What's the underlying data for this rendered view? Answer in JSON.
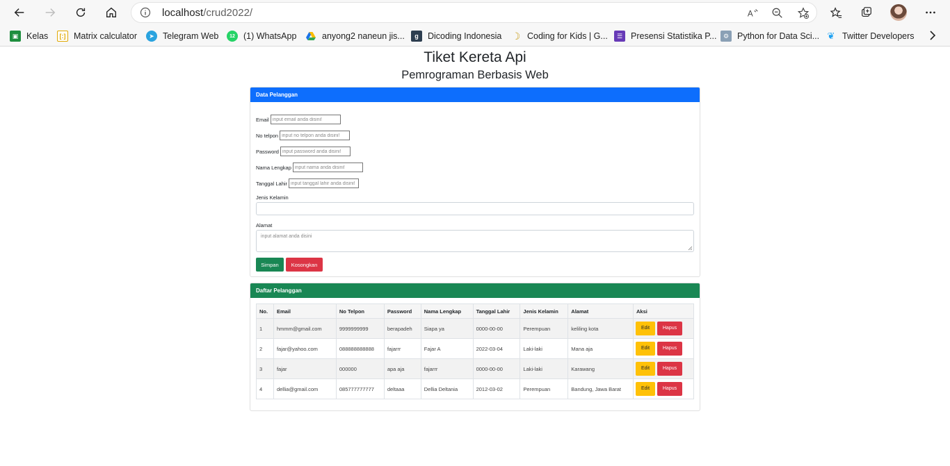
{
  "browser": {
    "url_host": "localhost",
    "url_path": "/crud2022/",
    "bookmarks": [
      {
        "label": "Kelas",
        "icon": "classroom-icon",
        "color": "#1e8e3e"
      },
      {
        "label": "Matrix calculator",
        "icon": "matrix-icon",
        "color": "#e0a800"
      },
      {
        "label": "Telegram Web",
        "icon": "telegram-icon",
        "color": "#2aa3df"
      },
      {
        "label": "(1) WhatsApp",
        "icon": "whatsapp-icon",
        "color": "#25d366"
      },
      {
        "label": "anyong2 naneun jis...",
        "icon": "drive-icon",
        "color": "#fbbc04"
      },
      {
        "label": "Dicoding Indonesia",
        "icon": "dicoding-icon",
        "color": "#2d3e50"
      },
      {
        "label": "Coding for Kids | G...",
        "icon": "banana-icon",
        "color": "#c9a227"
      },
      {
        "label": "Presensi Statistika P...",
        "icon": "forms-icon",
        "color": "#673ab7"
      },
      {
        "label": "Python for Data Sci...",
        "icon": "python-icon",
        "color": "#8aa0b5"
      },
      {
        "label": "Twitter Developers",
        "icon": "twitter-icon",
        "color": "#1da1f2"
      }
    ]
  },
  "page": {
    "title": "Tiket Kereta Api",
    "subtitle": "Pemrograman Berbasis Web"
  },
  "form": {
    "header": "Data Pelanggan",
    "email_label": "Email",
    "email_placeholder": "input email anda disini!",
    "phone_label": "No telpon",
    "phone_placeholder": "input no telpon anda disini!",
    "password_label": "Password",
    "password_placeholder": "input password anda disini!",
    "name_label": "Nama Lengkap",
    "name_placeholder": "input nama anda disini!",
    "dob_label": "Tanggal Lahir",
    "dob_placeholder": "input tanggal lahir anda disini!",
    "gender_label": "Jenis Kelamin",
    "gender_value": "",
    "address_label": "Alamat",
    "address_placeholder": "input alamat anda disini",
    "save_label": "Simpan",
    "clear_label": "Kosongkan",
    "colors": {
      "primary": "#0d6efd",
      "success": "#198754",
      "danger": "#dc3545",
      "warning": "#ffc107"
    }
  },
  "table": {
    "header": "Daftar Pelanggan",
    "columns": [
      "No.",
      "Email",
      "No Telpon",
      "Password",
      "Nama Lengkap",
      "Tanggal Lahir",
      "Jenis Kelamin",
      "Alamat",
      "Aksi"
    ],
    "rows": [
      [
        "1",
        "hmmm@gmail.com",
        "9999999999",
        "berapadeh",
        "Siapa ya",
        "0000-00-00",
        "Perempuan",
        "keliling kota"
      ],
      [
        "2",
        "fajar@yahoo.com",
        "088888888888",
        "fajarrr",
        "Fajar A",
        "2022-03-04",
        "Laki-laki",
        "Mana aja"
      ],
      [
        "3",
        "fajar",
        "000000",
        "apa aja",
        "fajarrr",
        "0000-00-00",
        "Laki-laki",
        "Karawang"
      ],
      [
        "4",
        "dellia@gmail.com",
        "085777777777",
        "deltaaa",
        "Dellia Deltania",
        "2012-03-02",
        "Perempuan",
        "Bandung, Jawa Barat"
      ]
    ],
    "edit_label": "Edit",
    "delete_label": "Hapus"
  }
}
